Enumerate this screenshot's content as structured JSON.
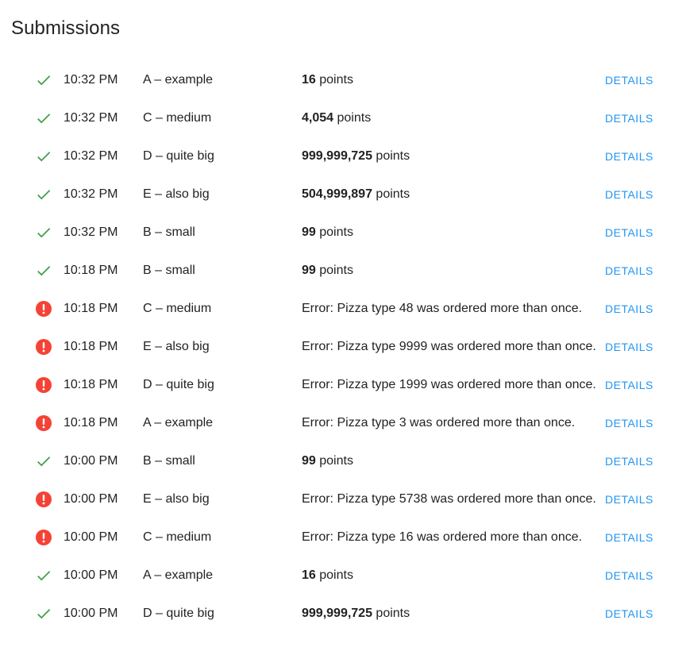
{
  "page": {
    "title": "Submissions"
  },
  "labels": {
    "details": "DETAILS",
    "points_suffix": "points"
  },
  "colors": {
    "success": "#43a047",
    "error": "#f44336",
    "link": "#2196f3"
  },
  "submissions": [
    {
      "status": "success",
      "time": "10:32 PM",
      "problem": "A – example",
      "score": "16",
      "error": null
    },
    {
      "status": "success",
      "time": "10:32 PM",
      "problem": "C – medium",
      "score": "4,054",
      "error": null
    },
    {
      "status": "success",
      "time": "10:32 PM",
      "problem": "D – quite big",
      "score": "999,999,725",
      "error": null
    },
    {
      "status": "success",
      "time": "10:32 PM",
      "problem": "E – also big",
      "score": "504,999,897",
      "error": null
    },
    {
      "status": "success",
      "time": "10:32 PM",
      "problem": "B – small",
      "score": "99",
      "error": null
    },
    {
      "status": "success",
      "time": "10:18 PM",
      "problem": "B – small",
      "score": "99",
      "error": null
    },
    {
      "status": "error",
      "time": "10:18 PM",
      "problem": "C – medium",
      "score": null,
      "error": "Error: Pizza type 48 was ordered more than once."
    },
    {
      "status": "error",
      "time": "10:18 PM",
      "problem": "E – also big",
      "score": null,
      "error": "Error: Pizza type 9999 was ordered more than once."
    },
    {
      "status": "error",
      "time": "10:18 PM",
      "problem": "D – quite big",
      "score": null,
      "error": "Error: Pizza type 1999 was ordered more than once."
    },
    {
      "status": "error",
      "time": "10:18 PM",
      "problem": "A – example",
      "score": null,
      "error": "Error: Pizza type 3 was ordered more than once."
    },
    {
      "status": "success",
      "time": "10:00 PM",
      "problem": "B – small",
      "score": "99",
      "error": null
    },
    {
      "status": "error",
      "time": "10:00 PM",
      "problem": "E – also big",
      "score": null,
      "error": "Error: Pizza type 5738 was ordered more than once."
    },
    {
      "status": "error",
      "time": "10:00 PM",
      "problem": "C – medium",
      "score": null,
      "error": "Error: Pizza type 16 was ordered more than once."
    },
    {
      "status": "success",
      "time": "10:00 PM",
      "problem": "A – example",
      "score": "16",
      "error": null
    },
    {
      "status": "success",
      "time": "10:00 PM",
      "problem": "D – quite big",
      "score": "999,999,725",
      "error": null
    }
  ]
}
